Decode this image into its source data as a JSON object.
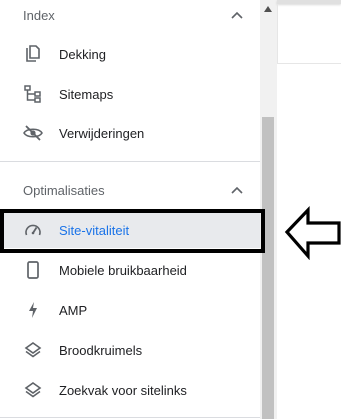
{
  "sections": [
    {
      "title": "Index",
      "items": [
        {
          "label": "Dekking",
          "icon": "file-copy-icon"
        },
        {
          "label": "Sitemaps",
          "icon": "sitemap-icon"
        },
        {
          "label": "Verwijderingen",
          "icon": "visibility-off-icon"
        }
      ]
    },
    {
      "title": "Optimalisaties",
      "items": [
        {
          "label": "Site-vitaliteit",
          "icon": "speed-gauge-icon",
          "active": true
        },
        {
          "label": "Mobiele bruikbaarheid",
          "icon": "smartphone-icon"
        },
        {
          "label": "AMP",
          "icon": "bolt-icon"
        },
        {
          "label": "Broodkruimels",
          "icon": "layers-icon"
        },
        {
          "label": "Zoekvak voor sitelinks",
          "icon": "layers-icon"
        }
      ]
    }
  ],
  "colors": {
    "active_text": "#1a73e8",
    "active_bg": "#e8eaed",
    "icon": "#5f6368",
    "highlight_border": "#000000"
  }
}
